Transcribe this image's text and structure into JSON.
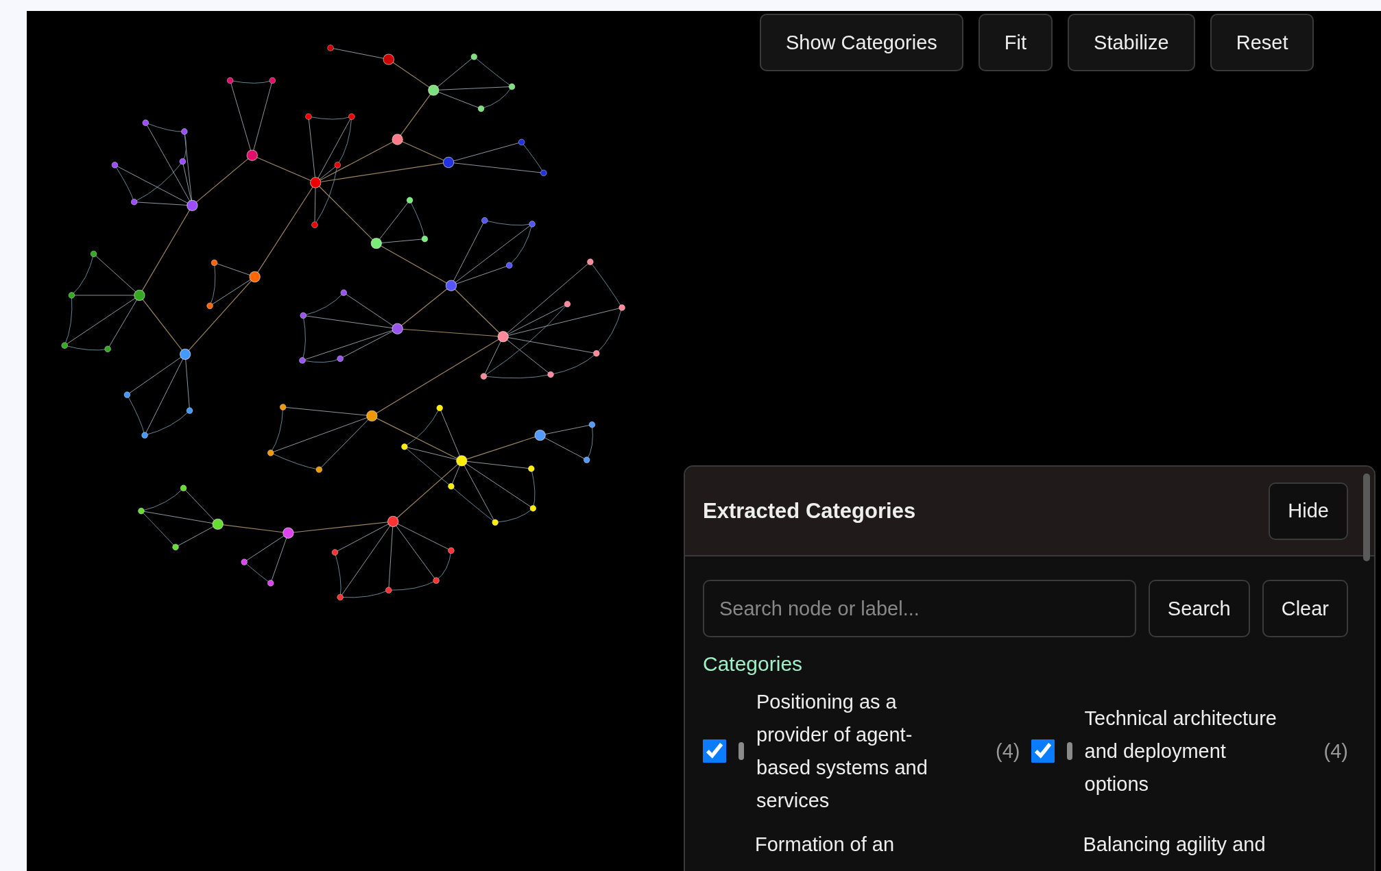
{
  "toolbar": {
    "buttons": [
      "Show Categories",
      "Fit",
      "Stabilize",
      "Reset"
    ]
  },
  "panel": {
    "title": "Extracted Categories",
    "hide_button": "Hide",
    "search": {
      "placeholder": "Search node or label..."
    },
    "search_button": "Search",
    "clear_button": "Clear",
    "section_title": "Categories",
    "categories": [
      {
        "label": "Positioning as a provider of agent-based systems and services",
        "count": "(4)",
        "checked": true,
        "color": "#8a8a8a"
      },
      {
        "label": "Technical architecture and deployment options",
        "count": "(4)",
        "checked": true,
        "color": "#8a8a8a"
      }
    ],
    "cut_off_categories": [
      {
        "label": "Formation of an"
      },
      {
        "label": "Balancing agility and"
      }
    ]
  }
}
